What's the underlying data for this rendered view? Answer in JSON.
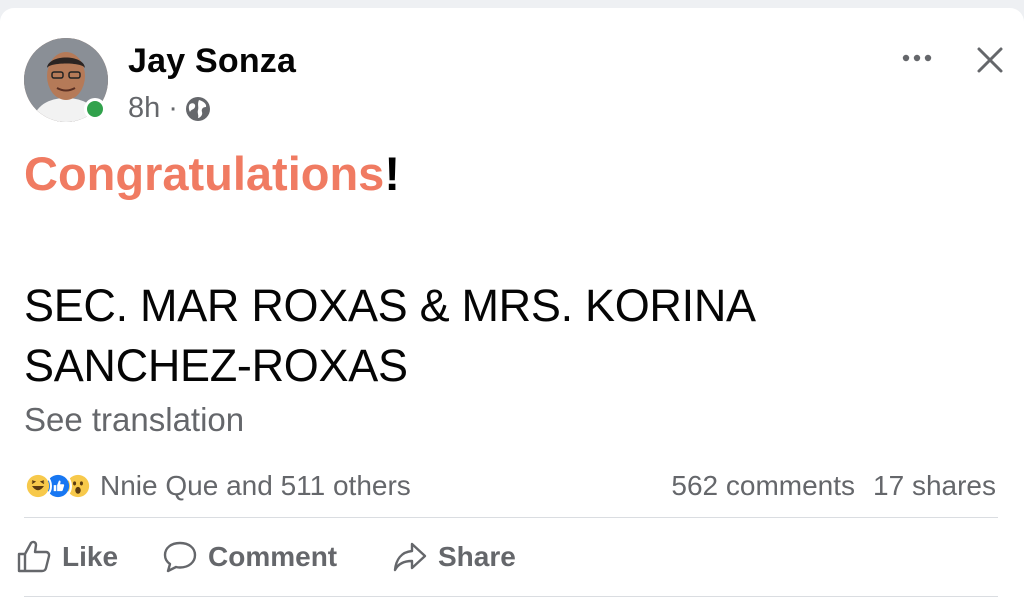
{
  "post": {
    "author": "Jay Sonza",
    "time": "8h",
    "separator": "·",
    "congrats_word": "Congratulations",
    "congrats_punct": "!",
    "names_line1": "SEC. MAR ROXAS & MRS. KORINA",
    "names_line2": "SANCHEZ-ROXAS",
    "see_translation": "See translation"
  },
  "engagement": {
    "reactors": "Nnie Que and 511 others",
    "comments": "562 comments",
    "shares": "17 shares",
    "reaction_icons": [
      "haha-reaction-icon",
      "like-reaction-icon",
      "wow-reaction-icon"
    ]
  },
  "actions": {
    "like": "Like",
    "comment": "Comment",
    "share": "Share"
  },
  "colors": {
    "accent": "#f07b62",
    "online": "#31a24c",
    "muted": "#65676b",
    "like_blue": "#1877f2"
  },
  "icons": {
    "audience": "globe-icon",
    "more": "more-icon",
    "close": "close-icon"
  }
}
